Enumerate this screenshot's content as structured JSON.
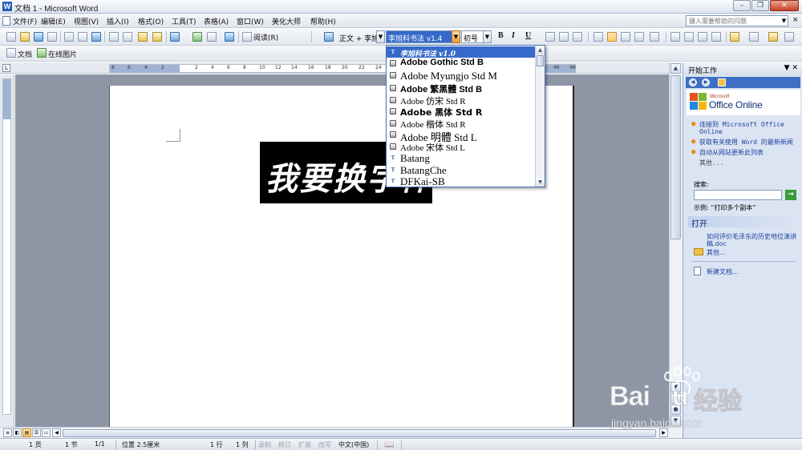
{
  "window": {
    "title": "文档 1 - Microsoft Word",
    "app_icon": "W",
    "controls": [
      "minimize",
      "maximize",
      "close"
    ]
  },
  "menubar": {
    "items": [
      "文件(F)",
      "编辑(E)",
      "视图(V)",
      "插入(I)",
      "格式(O)",
      "工具(T)",
      "表格(A)",
      "窗口(W)",
      "美化大师",
      "帮助(H)"
    ],
    "help_placeholder": "键入需要帮助的问题",
    "close_glyph": "×"
  },
  "toolbar1": {
    "read_label": "阅读(R)",
    "style_value": "正文 + 李旭",
    "font_value": "李旭科书法 v1.4",
    "size_value": "初号",
    "bold": "B",
    "italic": "I",
    "underline": "U"
  },
  "toolbar2": {
    "doc_label": "文档",
    "online_pic_label": "在线图片"
  },
  "ruler": {
    "corner": "L",
    "numbers": [
      "8",
      "6",
      "4",
      "2",
      "2",
      "4",
      "6",
      "8",
      "10",
      "12",
      "14",
      "16",
      "18",
      "20",
      "22",
      "24",
      "40",
      "42",
      "44",
      "46",
      "48"
    ]
  },
  "document": {
    "banner_text": "我要换字体"
  },
  "font_dropdown": {
    "items": [
      {
        "label": "李旭科书法 v1.0",
        "icon": "truetype-icon",
        "selected": true
      },
      {
        "label": "Adobe Gothic Std B",
        "icon": "opentype-icon",
        "selected": false
      },
      {
        "label": "Adobe Myungjo Std M",
        "icon": "opentype-icon",
        "selected": false
      },
      {
        "label": "Adobe 繁黑體 Std B",
        "icon": "opentype-icon",
        "selected": false
      },
      {
        "label": "Adobe 仿宋 Std R",
        "icon": "opentype-icon",
        "selected": false
      },
      {
        "label": "Adobe 黑体 Std R",
        "icon": "opentype-icon",
        "selected": false
      },
      {
        "label": "Adobe 楷体 Std R",
        "icon": "opentype-icon",
        "selected": false
      },
      {
        "label": "Adobe 明體 Std L",
        "icon": "opentype-icon",
        "selected": false
      },
      {
        "label": "Adobe 宋体 Std L",
        "icon": "opentype-icon",
        "selected": false
      },
      {
        "label": "Batang",
        "icon": "truetype-icon",
        "selected": false
      },
      {
        "label": "BatangChe",
        "icon": "truetype-icon",
        "selected": false
      },
      {
        "label": "DFKai-SB",
        "icon": "truetype-icon",
        "selected": false
      }
    ]
  },
  "taskpane": {
    "title": "开始工作",
    "brand_small": "Microsoft",
    "brand": "Office Online",
    "links": [
      "连接到 Microsoft Office Online",
      "获取有关使用 Word 的最新新闻",
      "自动从网站更新此列表"
    ],
    "more_label": "其他...",
    "search_label": "搜索:",
    "search_go": "→",
    "example_label": "示例: “打印多个副本”",
    "open_section": "打开",
    "recent_file": "如何评价毛泽东的历史地位演讲稿.doc",
    "open_more": "其他...",
    "new_doc": "新建文档..."
  },
  "statusbar": {
    "page": "1 页",
    "section": "1 节",
    "page_of": "1/1",
    "position": "位置 2.5厘米",
    "line": "1 行",
    "column": "1 列",
    "rec": "录制",
    "trk": "修订",
    "ext": "扩展",
    "ovr": "改写",
    "language": "中文(中国)"
  },
  "watermark": {
    "brand": "Bai",
    "brand_end": "u",
    "jingyan": "经验",
    "url": "jingyan.baidu.com"
  }
}
